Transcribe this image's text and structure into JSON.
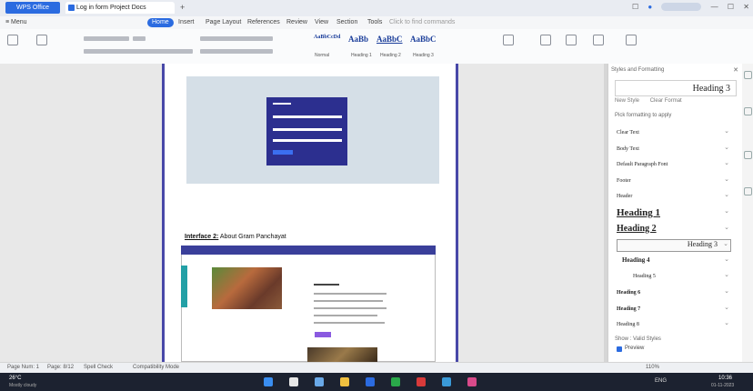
{
  "titlebar": {
    "app_tab": "WPS Office",
    "doc_tab": "Log in form Project Docs",
    "add_tab": "+",
    "right_icons": [
      "☐",
      "●"
    ],
    "user": "",
    "window_controls": [
      "—",
      "☐",
      "✕"
    ]
  },
  "menubar": {
    "items": [
      "≡ Menu",
      "Home",
      "Insert",
      "Page Layout",
      "References",
      "Review",
      "View",
      "Section",
      "Tools",
      "Click to find commands"
    ],
    "active_index": 1
  },
  "ribbon": {
    "style_samples": [
      "AaBbCcDd",
      "AaBb",
      "AaBbC",
      "AaBbC"
    ],
    "style_names": [
      "Normal",
      "Heading 1",
      "Heading 2",
      "Heading 3"
    ]
  },
  "document": {
    "caption_label": "Interface 2:",
    "caption_text": "About Gram Panchayat"
  },
  "styles_pane": {
    "title": "Styles and Formatting",
    "close": "✕",
    "preview_text": "Heading 3",
    "mini_buttons": [
      "New Style",
      "Clear Format"
    ],
    "filter_label": "Pick formatting to apply",
    "items": [
      {
        "label": "Clear Text",
        "size": 6,
        "bold": false,
        "underline": false
      },
      {
        "label": "Body Text",
        "size": 6,
        "bold": false,
        "underline": false
      },
      {
        "label": "Default Paragraph Font",
        "size": 6,
        "bold": false,
        "underline": false
      },
      {
        "label": "Footer",
        "size": 6,
        "bold": false,
        "underline": false
      },
      {
        "label": "Header",
        "size": 6,
        "bold": false,
        "underline": false
      },
      {
        "label": "Heading 1",
        "size": 11,
        "bold": true,
        "underline": true
      },
      {
        "label": "Heading 2",
        "size": 10,
        "bold": true,
        "underline": true
      },
      {
        "label": "Heading 3",
        "size": 8,
        "bold": false,
        "underline": false
      },
      {
        "label": "Heading 4",
        "size": 7,
        "bold": true,
        "underline": false
      },
      {
        "label": "Heading 5",
        "size": 6,
        "bold": false,
        "underline": false
      },
      {
        "label": "Heading 6",
        "size": 6,
        "bold": true,
        "underline": false
      },
      {
        "label": "Heading 7",
        "size": 6,
        "bold": true,
        "underline": false
      },
      {
        "label": "Heading 8",
        "size": 6,
        "bold": false,
        "underline": false
      }
    ],
    "selected_index": 7,
    "footer_label": "Show : Valid Styles",
    "checkbox_label": "Preview"
  },
  "statusbar": {
    "left": [
      "Page Num: 1",
      "Page: 8/12",
      "Spell Check",
      "Compatibility Mode"
    ],
    "right_zoom": "110%"
  },
  "taskbar": {
    "weather_temp": "26°C",
    "weather_desc": "Mostly cloudy",
    "language": "ENG",
    "time": "10:36",
    "date": "01-11-2023"
  },
  "colors": {
    "accent": "#2b6be0",
    "page_border": "#4848a8",
    "login_panel": "#2c2f8f",
    "site_nav": "#3a3f9a"
  }
}
